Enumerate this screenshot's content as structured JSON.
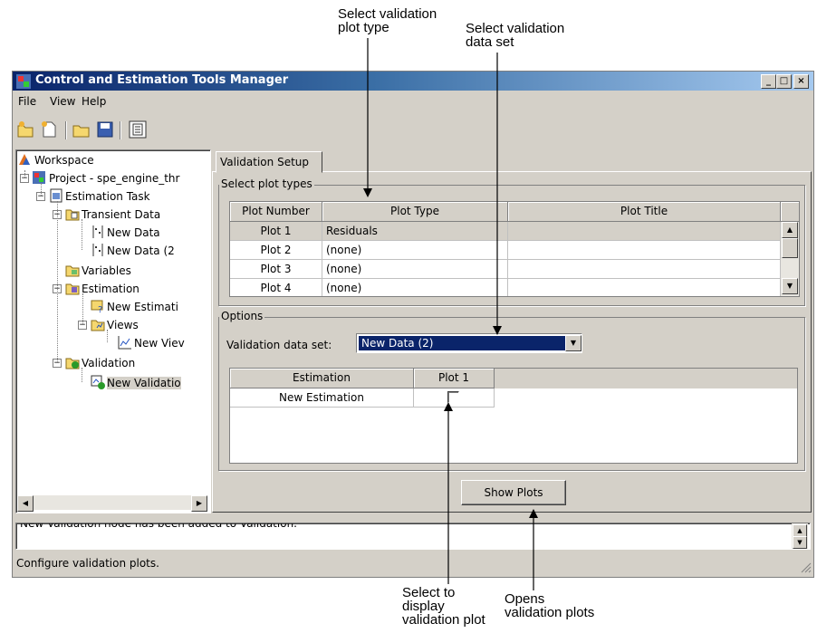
{
  "annotations": {
    "plot_type": [
      "Select validation",
      "plot type"
    ],
    "data_set": [
      "Select validation",
      "data set"
    ],
    "display_plot": [
      "Select to",
      "display",
      "validation plot"
    ],
    "opens_plots": [
      "Opens",
      "validation plots"
    ]
  },
  "window": {
    "title": "Control and Estimation Tools Manager",
    "min_label": "_",
    "max_label": "□",
    "close_label": "×"
  },
  "menu": [
    "File",
    "View",
    "Help"
  ],
  "toolbar": [
    "new-project-icon",
    "new-task-icon",
    "open-icon",
    "save-icon",
    "show-hide-icon"
  ],
  "tree": {
    "workspace": "Workspace",
    "project": "Project - spe_engine_thr",
    "estimation_task": "Estimation Task",
    "transient_data": "Transient Data",
    "new_data": "New Data",
    "new_data_2": "New Data (2",
    "variables": "Variables",
    "estimation": "Estimation",
    "new_estimation": "New Estimati",
    "views": "Views",
    "new_view": "New Viev",
    "validation": "Validation",
    "new_validation": "New Validatio"
  },
  "tab": {
    "label": "Validation Setup"
  },
  "plot_types": {
    "group_label": "Select plot types",
    "headers": [
      "Plot Number",
      "Plot Type",
      "Plot Title"
    ],
    "rows": [
      [
        "Plot 1",
        "Residuals",
        ""
      ],
      [
        "Plot 2",
        "(none)",
        ""
      ],
      [
        "Plot 3",
        "(none)",
        ""
      ],
      [
        "Plot 4",
        "(none)",
        ""
      ]
    ]
  },
  "options": {
    "group_label": "Options",
    "dataset_label": "Validation data set:",
    "dataset_value": "New Data (2)",
    "headers": [
      "Estimation",
      "Plot 1"
    ],
    "rows": [
      [
        "New Estimation",
        false
      ]
    ]
  },
  "show_plots_label": "Show Plots",
  "message": "New Validation node has been added to Validation.",
  "status": "Configure validation plots."
}
